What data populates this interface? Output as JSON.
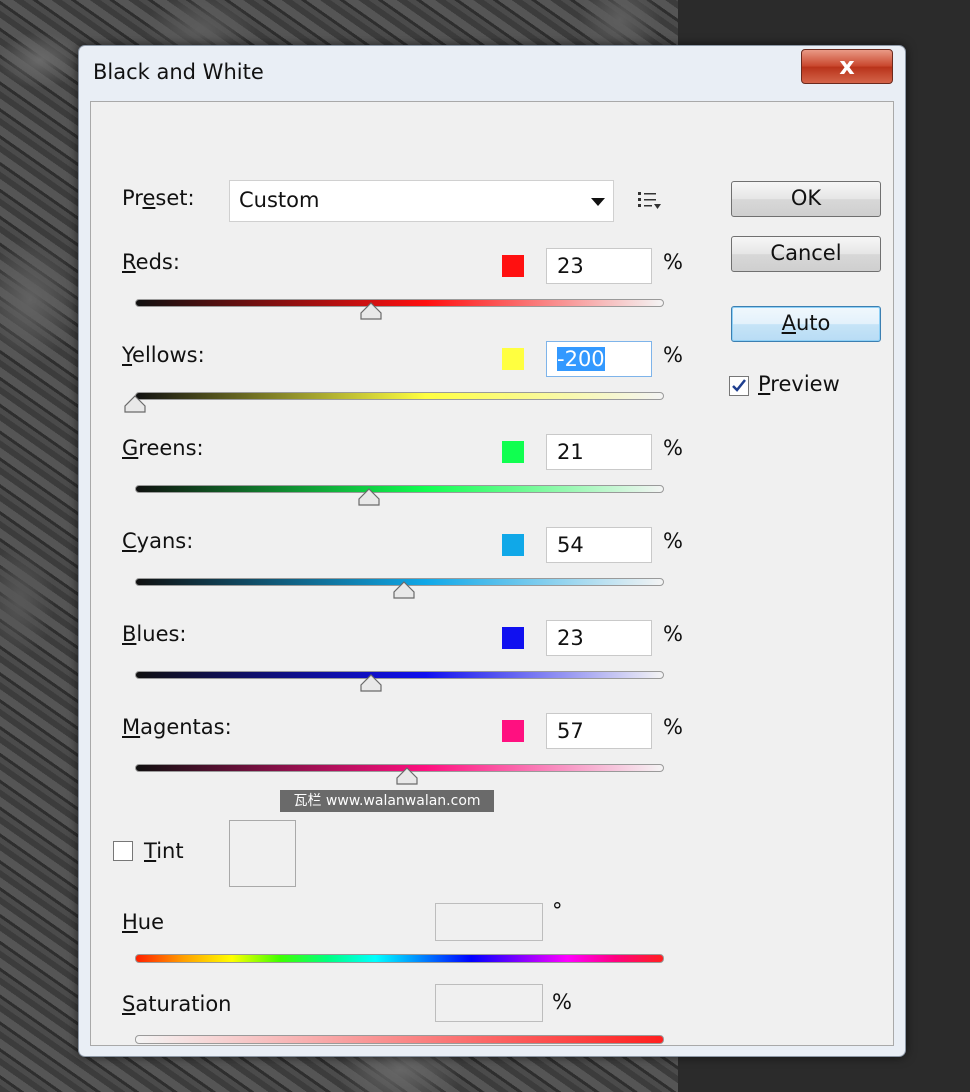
{
  "window": {
    "title": "Black and White",
    "close_glyph": "x"
  },
  "preset": {
    "label_pre": "Pr",
    "label_u": "e",
    "label_post": "set:",
    "value": "Custom"
  },
  "buttons": {
    "ok": "OK",
    "cancel": "Cancel",
    "auto_u": "A",
    "auto_rest": "uto"
  },
  "preview": {
    "label_u": "P",
    "label_rest": "review",
    "checked": true
  },
  "sliders": [
    {
      "label_u": "R",
      "label_rest": "eds:",
      "value": "23",
      "unit": "%",
      "color": "#ff1010",
      "min": -200,
      "max": 300
    },
    {
      "label_u": "Y",
      "label_rest": "ellows:",
      "value": "-200",
      "unit": "%",
      "color": "#ffff40",
      "min": -200,
      "max": 300
    },
    {
      "label_u": "G",
      "label_rest": "reens:",
      "value": "21",
      "unit": "%",
      "color": "#10ff50",
      "min": -200,
      "max": 300
    },
    {
      "label_u": "C",
      "label_rest": "yans:",
      "value": "54",
      "unit": "%",
      "color": "#10a8e8",
      "min": -200,
      "max": 300
    },
    {
      "label_u": "B",
      "label_rest": "lues:",
      "value": "23",
      "unit": "%",
      "color": "#1010f0",
      "min": -200,
      "max": 300
    },
    {
      "label_u": "M",
      "label_rest": "agentas:",
      "value": "57",
      "unit": "%",
      "color": "#ff1080",
      "min": -200,
      "max": 300
    }
  ],
  "tint": {
    "label_u": "T",
    "label_rest": "int",
    "checked": false
  },
  "hue": {
    "label_u": "H",
    "label_rest": "ue",
    "unit": "°"
  },
  "saturation": {
    "label_u": "S",
    "label_rest": "aturation",
    "unit": "%"
  },
  "watermark": "瓦栏 www.walanwalan.com"
}
